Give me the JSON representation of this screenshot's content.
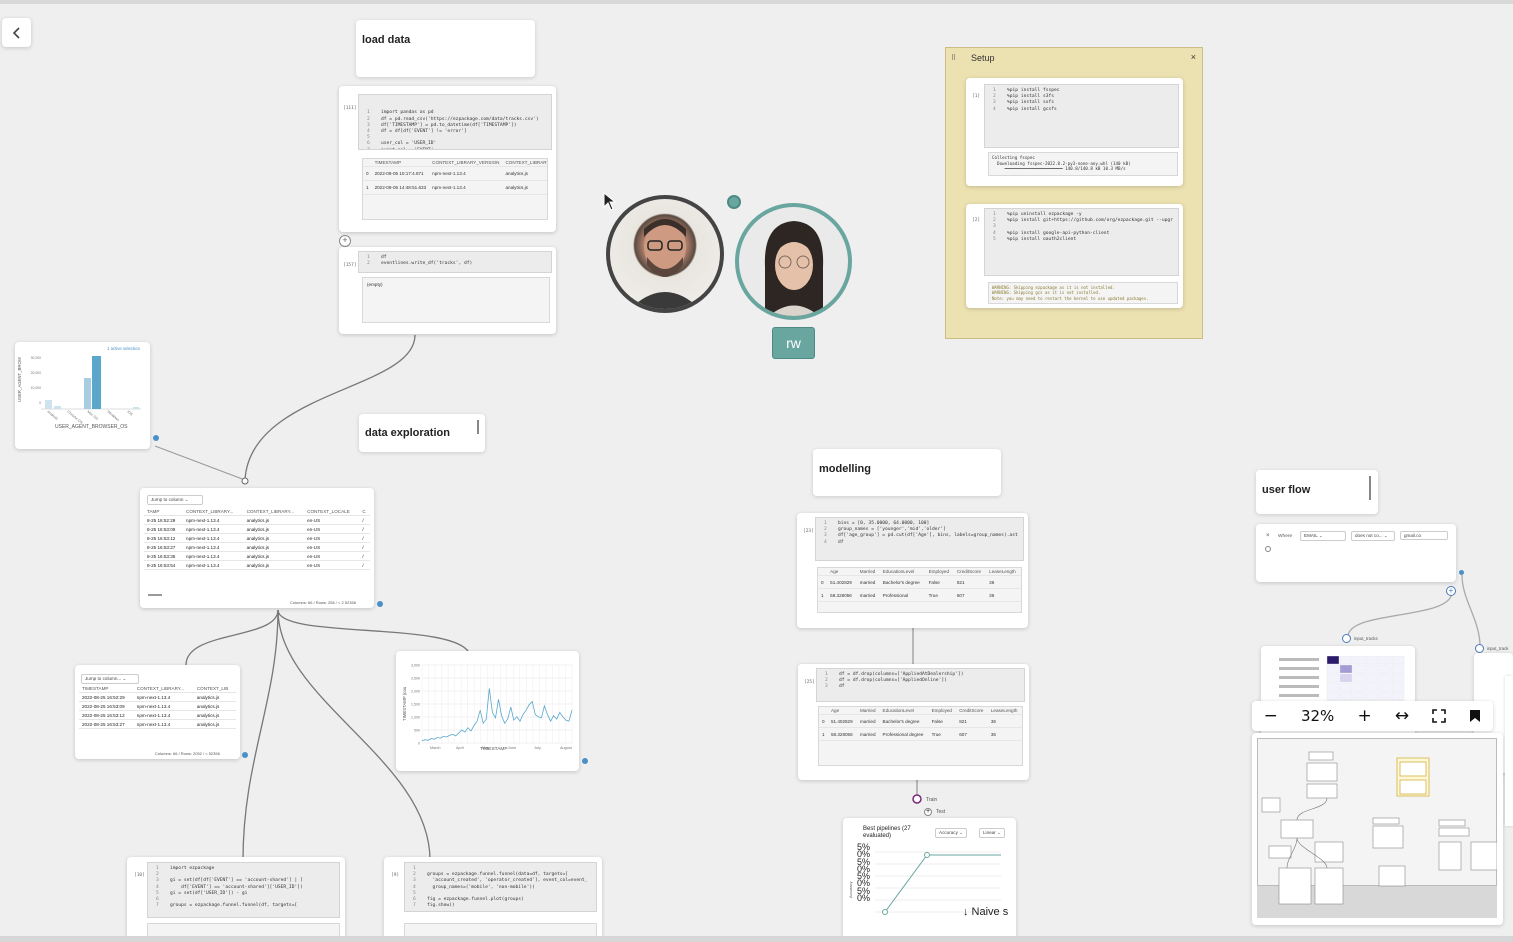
{
  "nav": {
    "back_icon": "chevron-left-icon"
  },
  "titles": {
    "load_data": "load data",
    "data_exploration": "data exploration",
    "modelling": "modelling",
    "user_flow": "user flow"
  },
  "setup": {
    "title": "Setup",
    "close": "×",
    "cell1_no": "[1]",
    "cell1_code": [
      "%pip install fsspec",
      "%pip install s3fs",
      "%pip install sxfs",
      "%pip install gcsfs"
    ],
    "cell1_out": [
      "Collecting fsspec",
      "  Downloading fsspec-2022.8.2-py3-none-any.whl (140 kB)",
      "     ━━━━━━━━━━━━━━━━━━━━━━━ 140.8/140.8 kB 10.3 MB/s"
    ],
    "cell2_no": "[2]",
    "cell2_code": [
      "%pip uninstall ezpackage -y",
      "%pip install git+https://github.com/org/ezpackage.git --upgr",
      "",
      "%pip install google-api-python-client",
      "%pip install oauth2client"
    ],
    "cell2_out": [
      "WARNING: Skipping ezpackage as it is not installed.",
      "WARNING: Skipping gcs as it is not installed.",
      "Note: you may need to restart the kernel to use updated packages."
    ]
  },
  "load_cell": {
    "no": "[111]",
    "code": [
      "import pandas as pd",
      "df = pd.read_csv('https://ezpackage.com/data/tracks.csv')",
      "df['TIMESTAMP'] = pd.to_datetime(df['TIMESTAMP'])",
      "df = df[df['EVENT'] != 'error']",
      "",
      "user_col = 'USER_ID'",
      "event_col = 'EVENT'"
    ],
    "out_headers": [
      "",
      "TIMESTAMP",
      "CONTEXT_LIBRARY_VERSION",
      "CONTEXT_LIBRARY_NAME"
    ],
    "out_rows": [
      [
        "0",
        "2022-08-05 10:17:4.871",
        "npm-next-1.13.4",
        "analytics.js"
      ],
      [
        "1",
        "2022-08-05 14:48:51.633",
        "npm-next-1.13.4",
        "analytics.js"
      ]
    ]
  },
  "write_cell": {
    "no": "[157]",
    "code": [
      "df",
      "eventlines.write_df('tracks', df)"
    ],
    "out": "(empty)"
  },
  "bar_chart": {
    "selection": "1 active selection",
    "ylabel": "USER_AGENT_BROW",
    "xlabel": "USER_AGENT_BROWSER_OS",
    "yticks": [
      "30,000",
      "20,000",
      "10,000",
      "0"
    ]
  },
  "explore_table": {
    "jump": "Jump to column",
    "headers": [
      "TAMP",
      "CONTEXT_LIBRARY...",
      "CONTEXT_LIBRARY...",
      "CONTEXT_LOCALE",
      "C"
    ],
    "rows": [
      [
        "8-25 16:52:29",
        "npm-next-1.13.4",
        "analytics.js",
        "en-US",
        "/"
      ],
      [
        "8-25 16:53:09",
        "npm-next-1.13.4",
        "analytics.js",
        "en-US",
        "/"
      ],
      [
        "8-25 16:53:12",
        "npm-next-1.13.4",
        "analytics.js",
        "en-US",
        "/"
      ],
      [
        "8-25 16:53:27",
        "npm-next-1.13.4",
        "analytics.js",
        "en-US",
        "/"
      ],
      [
        "8-25 16:53:35",
        "npm-next-1.13.4",
        "analytics.js",
        "en-US",
        "/"
      ],
      [
        "8-25 16:53:54",
        "npm-next-1.13.4",
        "analytics.js",
        "en-US",
        "/"
      ]
    ],
    "footer": "Columns: 66 / Rows: 256 / < 2 52356"
  },
  "small_table": {
    "jump": "Jump to column...",
    "headers": [
      "TIMESTAMP",
      "CONTEXT_LIBRARY...",
      "CONTEXT_LIB"
    ],
    "rows": [
      [
        "2022-08-25 16:52:29",
        "npm-next-1.13.4",
        "analytics.js"
      ],
      [
        "2022-08-25 16:53:09",
        "npm-next-1.13.4",
        "analytics.js"
      ],
      [
        "2022-08-25 16:53:12",
        "npm-next-1.13.4",
        "analytics.js"
      ],
      [
        "2022-08-25 16:53:27",
        "npm-next-1.13.4",
        "analytics.js"
      ]
    ],
    "footer": "Columns: 66 / Rows: 2052 / < 52356"
  },
  "line_chart": {
    "ylabel": "TIMESTAMP (cou",
    "xlabel": "TIMESTAMP",
    "xticks": [
      "March",
      "April",
      "May",
      "June",
      "July",
      "August"
    ],
    "yticks": [
      "3,000",
      "2,500",
      "2,000",
      "1,500",
      "1,000",
      "500",
      "0"
    ]
  },
  "funnel_cell1": {
    "no": "[10]",
    "code": [
      "import ezpackage",
      "",
      "gi = set(df[df['EVENT'] == 'account-shared'] | [",
      "    df['EVENT'] == 'account-shared']['USER_ID'])",
      "gi = set(df['USER_ID']) - gi",
      "",
      "groups = ezpackage.funnel.funnel(df, targets=["
    ]
  },
  "funnel_cell2": {
    "no": "[9]",
    "code": [
      "",
      "groups = ezpackage.funnel.funnel(data=df, targets=[",
      "  'account_created', 'operator_created'], event_col=event_",
      "  group_names=('mobile', 'non-mobile'))",
      "",
      "fig = ezpackage.funnel.plot(groups)",
      "fig.show()"
    ]
  },
  "model_cell1": {
    "no": "[23]",
    "code": [
      "bins = [0, 35.0000, 64.0000, 100]",
      "group_names = ['younger','mid','older']",
      "df['age_group'] = pd.cut(df['Age'], bins, labels=group_names).ast",
      "df"
    ],
    "headers": [
      "",
      "Age",
      "Married",
      "EducationLevel",
      "Employed",
      "CreditScore",
      "LeaseLength"
    ],
    "rows": [
      [
        "0",
        "51.402829",
        "married",
        "Bachelor's degree",
        "False",
        "821",
        "36"
      ],
      [
        "1",
        "58.328056",
        "married",
        "Professional",
        "True",
        "607",
        "36"
      ]
    ]
  },
  "model_cell2": {
    "no": "[25]",
    "code": [
      "df = df.drop(columns=['AppliedAtDealership'])",
      "df = df.drop(columns=['AppliedOnline'])",
      "df"
    ],
    "headers": [
      "",
      "Age",
      "Married",
      "EducationLevel",
      "Employed",
      "CreditScore",
      "LeaseLength"
    ],
    "rows": [
      [
        "0",
        "51.402829",
        "married",
        "Bachelor's degree",
        "False",
        "821",
        "36"
      ],
      [
        "1",
        "58.328056",
        "married",
        "Professional degree",
        "True",
        "607",
        "36"
      ]
    ]
  },
  "train_labels": {
    "train": "Train",
    "test": "Test"
  },
  "pipeline": {
    "title": "Best pipelines (27 evaluated)",
    "metric": "Accuracy",
    "model": "Linear",
    "yticks": [
      "5%",
      "0%",
      "5%",
      "0%",
      "5%",
      "0%",
      "5%",
      "0%"
    ],
    "ylabel": "Accuracy",
    "legend": "↓ Naive s",
    "xlabel": "Time (s)"
  },
  "user_flow": {
    "where": "Where",
    "field": "EMAIL",
    "op": "does not co...",
    "value": "gmail.co",
    "node1": "input_tracks",
    "node2": "input_track"
  },
  "collab": {
    "initials": "rw"
  },
  "zoom": {
    "level": "32%",
    "minus": "−",
    "plus": "+"
  },
  "colors": {
    "accent": "#6aa6a0",
    "note": "#ece1b0",
    "bar": "#a8cde0",
    "line": "#5ba7cc"
  }
}
